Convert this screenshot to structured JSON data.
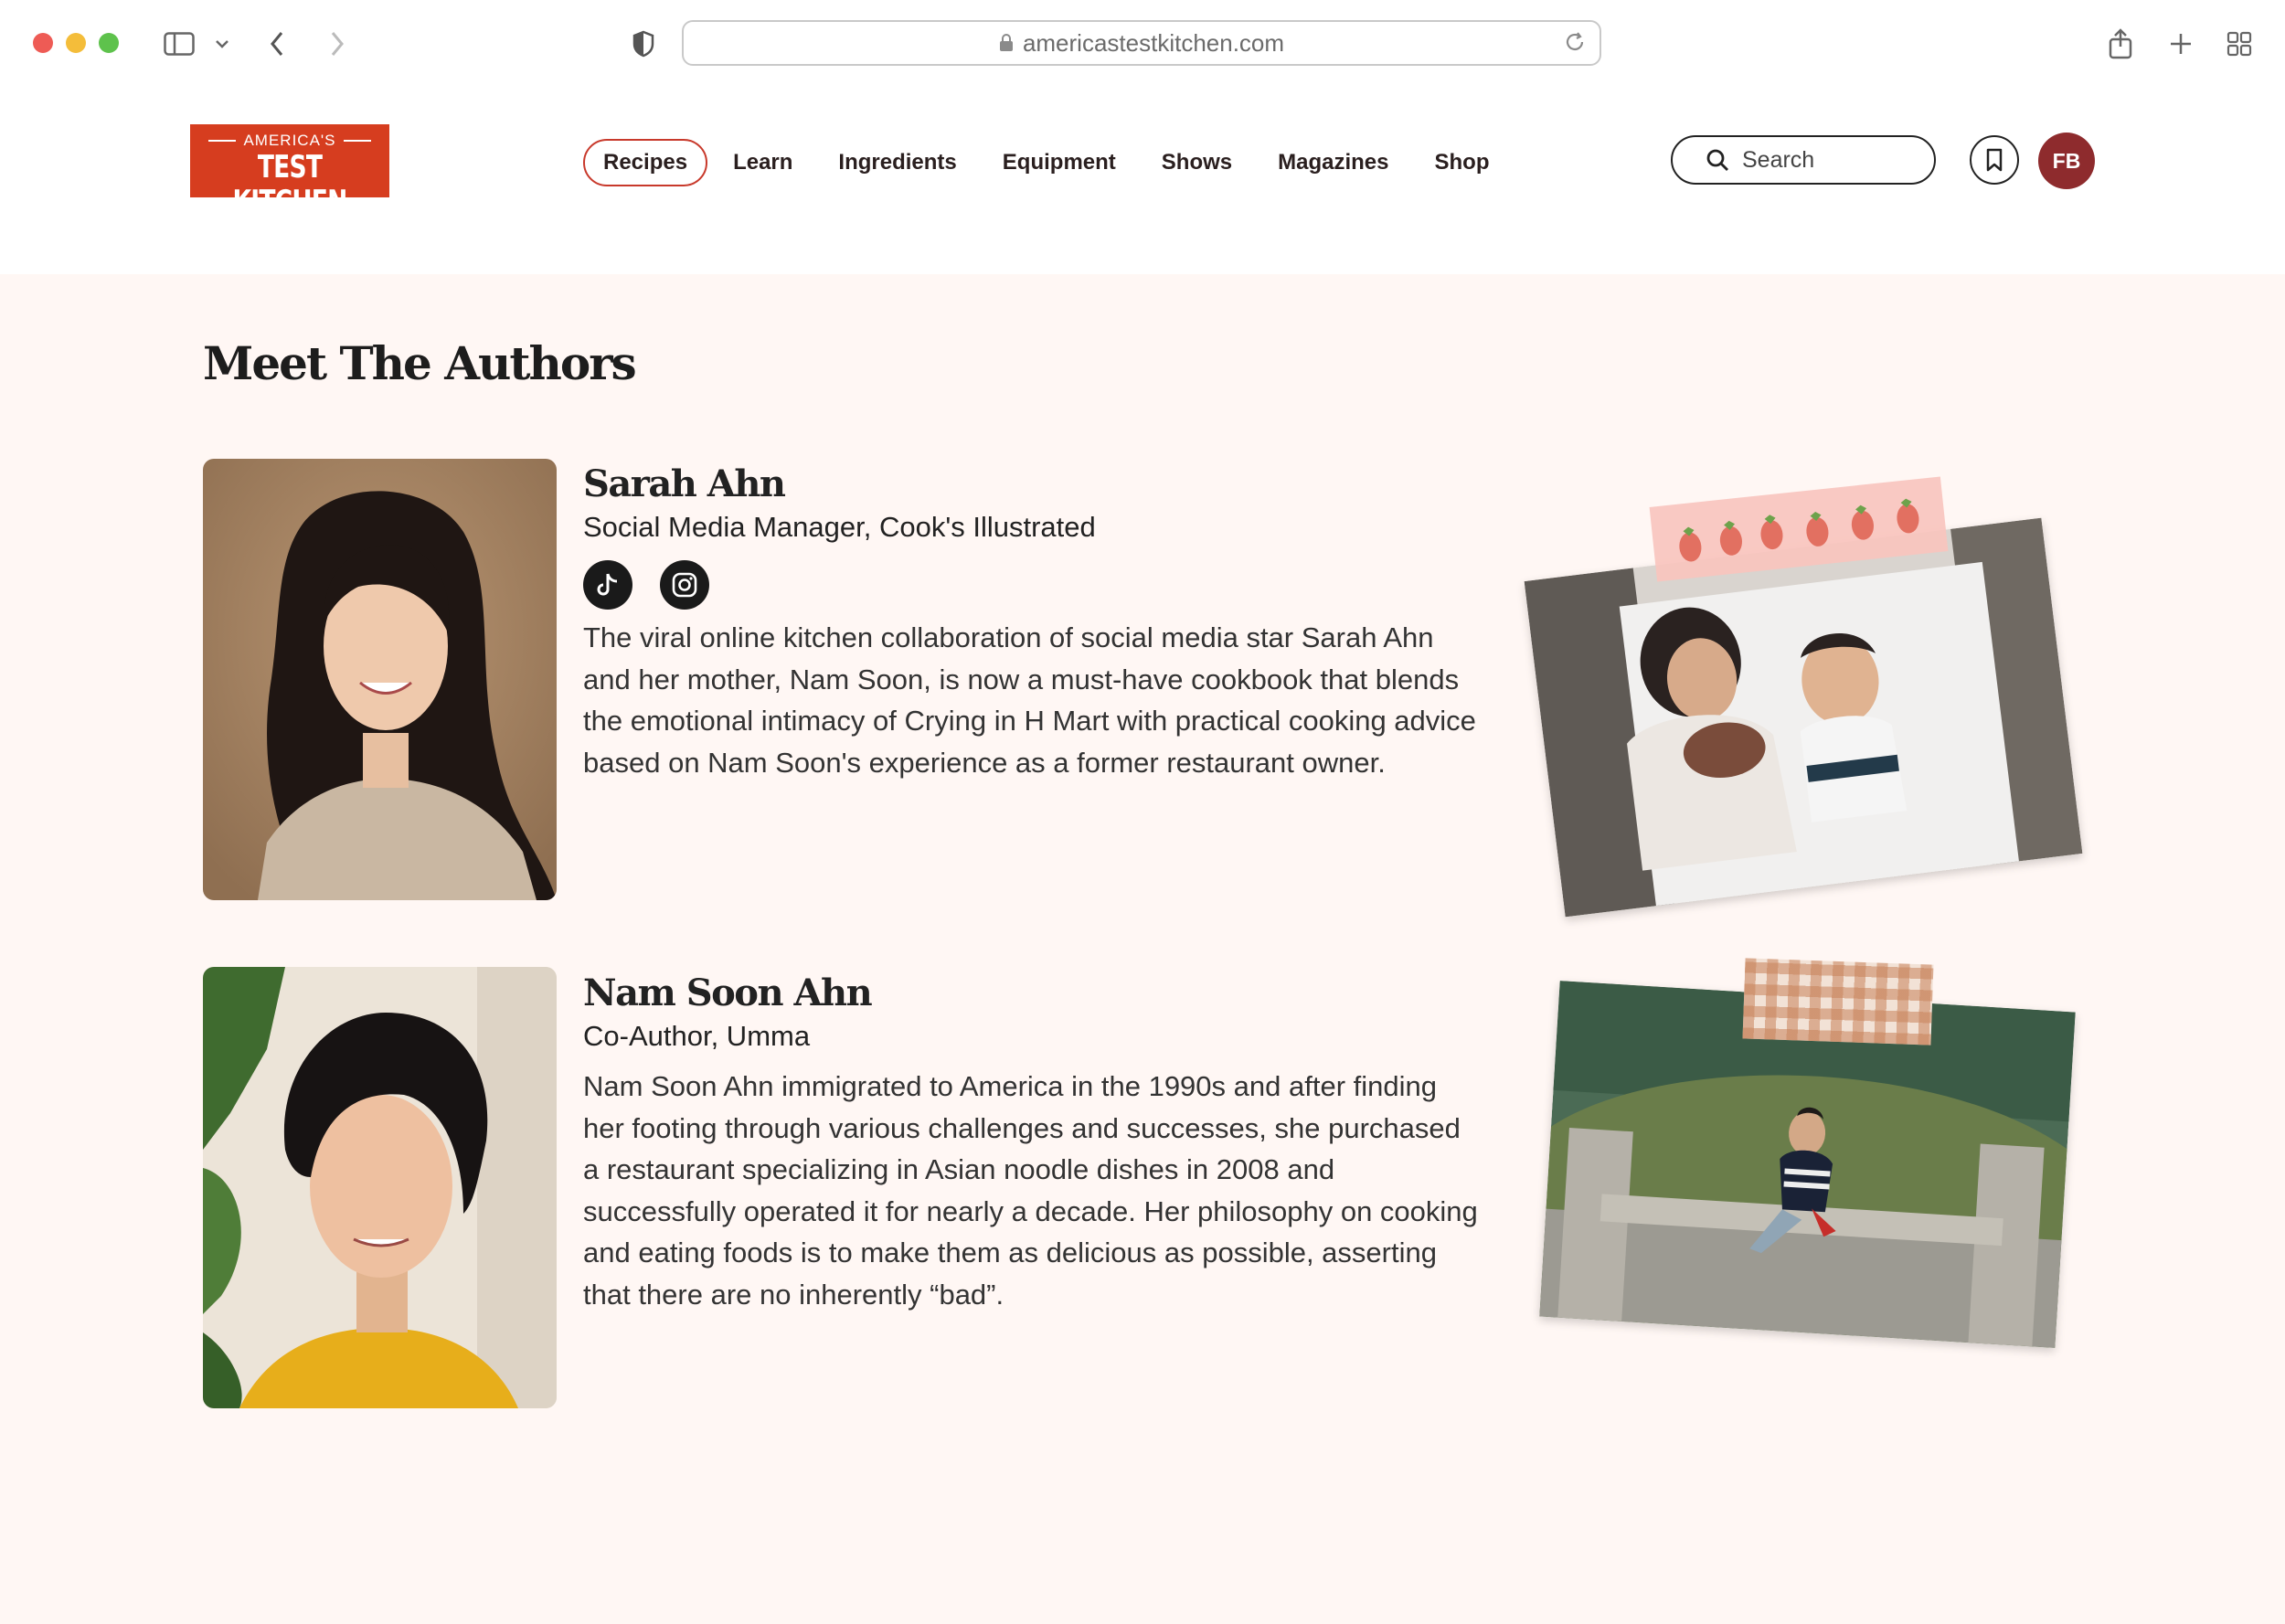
{
  "browser": {
    "url": "americastestkitchen.com"
  },
  "header": {
    "logo_top": "AMERICA'S",
    "logo_bottom": "TEST KITCHEN",
    "nav": [
      "Recipes",
      "Learn",
      "Ingredients",
      "Equipment",
      "Shows",
      "Magazines",
      "Shop"
    ],
    "active_nav": "Recipes",
    "search_placeholder": "Search",
    "user_initials": "FB"
  },
  "page_title": "Meet The Authors",
  "authors": [
    {
      "name": "Sarah Ahn",
      "role": "Social Media Manager, Cook's Illustrated",
      "socials": [
        "tiktok-icon",
        "instagram-icon"
      ],
      "bio": "The viral online kitchen collaboration of social media star Sarah Ahn and her mother, Nam Soon, is now a must-have cookbook that blends the emotional intimacy of Crying in H Mart with practical cooking advice based on Nam Soon's experience as a former restaurant owner."
    },
    {
      "name": "Nam Soon Ahn",
      "role": "Co-Author, Umma",
      "bio": "Nam Soon Ahn immigrated to America in the 1990s and after finding her footing through various challenges and successes, she purchased a restaurant specializing in Asian noodle dishes in 2008 and successfully operated it for nearly a decade. Her philosophy on cooking and eating foods is to make them as delicious as possible, asserting that there are no inherently “bad”."
    }
  ],
  "colors": {
    "brand_red": "#d63d1f",
    "page_bg": "#fff7f4",
    "avatar_bg": "#8e2b2d",
    "nav_active_border": "#c8392b"
  }
}
